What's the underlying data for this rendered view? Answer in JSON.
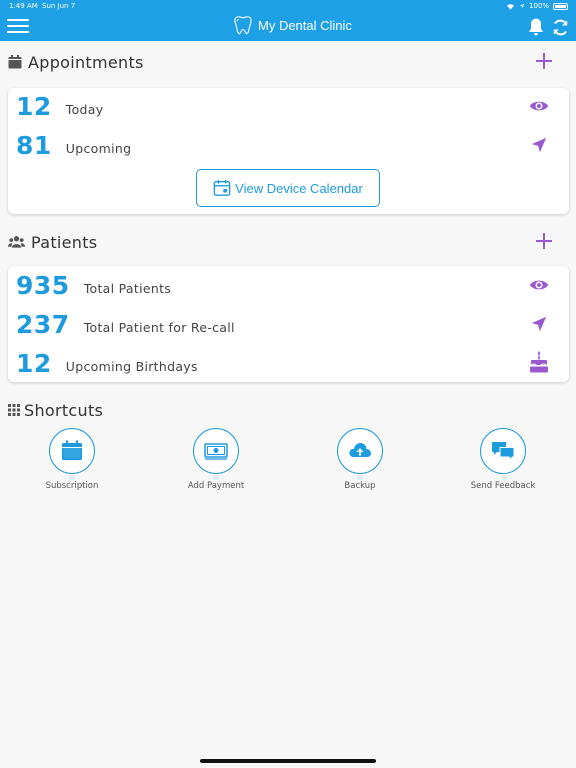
{
  "status_bar": {
    "time": "1:49 AM",
    "date": "Sun Jun 7",
    "battery": "100%"
  },
  "header": {
    "title": "My Dental Clinic"
  },
  "appointments": {
    "title": "Appointments",
    "rows": [
      {
        "value": "12",
        "label": "Today"
      },
      {
        "value": "81",
        "label": "Upcoming"
      }
    ],
    "calendar_button": "View Device Calendar"
  },
  "patients": {
    "title": "Patients",
    "rows": [
      {
        "value": "935",
        "label": "Total Patients"
      },
      {
        "value": "237",
        "label": "Total Patient for Re-call"
      },
      {
        "value": "12",
        "label": "Upcoming Birthdays"
      }
    ]
  },
  "shortcuts": {
    "title": "Shortcuts",
    "items": [
      {
        "label": "Subscription",
        "icon": "calendar-icon"
      },
      {
        "label": "Add Payment",
        "icon": "money-icon"
      },
      {
        "label": "Backup",
        "icon": "cloud-upload-icon"
      },
      {
        "label": "Send Feedback",
        "icon": "chat-bubbles-icon"
      }
    ]
  },
  "colors": {
    "brand": "#1ea0e6",
    "accent": "#9b59d0",
    "number": "#1e9bde"
  }
}
